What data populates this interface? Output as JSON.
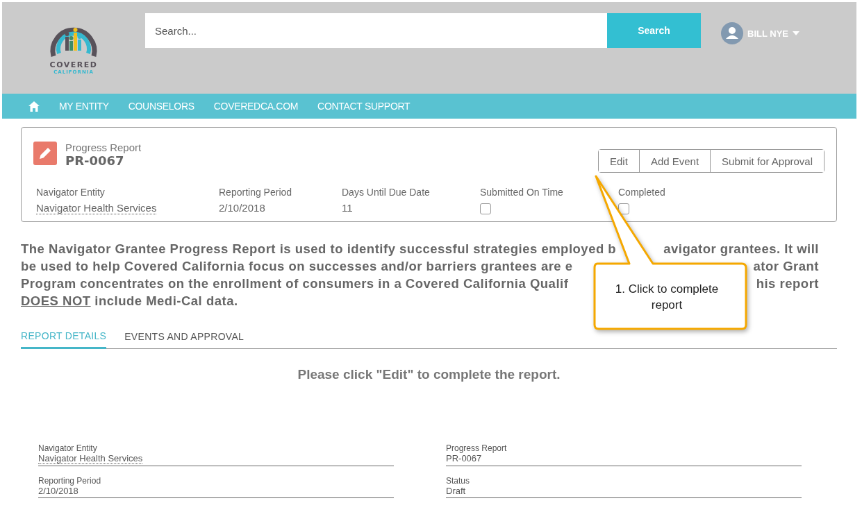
{
  "header": {
    "logo": {
      "line1": "COVERED",
      "line2": "CALIFORNIA"
    },
    "search": {
      "placeholder": "Search...",
      "button": "Search"
    },
    "user": {
      "name": "BILL NYE"
    }
  },
  "nav": {
    "items": [
      "MY ENTITY",
      "COUNSELORS",
      "COVEREDCA.COM",
      "CONTACT SUPPORT"
    ]
  },
  "record": {
    "type": "Progress Report",
    "name": "PR-0067",
    "actions": [
      "Edit",
      "Add Event",
      "Submit for Approval"
    ],
    "fields": [
      {
        "kind": "link",
        "label": "Navigator Entity",
        "value": "Navigator Health Services"
      },
      {
        "kind": "text",
        "label": "Reporting Period",
        "value": "2/10/2018"
      },
      {
        "kind": "text",
        "label": "Days Until Due Date",
        "value": "11"
      },
      {
        "kind": "checkbox",
        "label": "Submitted On Time",
        "checked": false
      },
      {
        "kind": "checkbox",
        "label": "Completed",
        "checked": false
      }
    ]
  },
  "intro": {
    "lines": [
      {
        "left": "The Navigator Grantee Progress Report is used to identify successful strategies employed b",
        "right": "avigator grantees. It will"
      },
      {
        "left": "be used to help Covered California focus on successes and/or barriers grantees are e",
        "right": "ator Grant"
      },
      {
        "left": "Program concentrates on the enrollment of consumers in a Covered California Qualif",
        "right": "his report"
      }
    ],
    "last_emphasis": "DOES NOT",
    "last_rest": " include Medi-Cal data."
  },
  "tabs": [
    {
      "label": "REPORT DETAILS",
      "selected": true
    },
    {
      "label": "EVENTS AND APPROVAL",
      "selected": false
    }
  ],
  "notice": "Please click \"Edit\" to complete the report.",
  "details": [
    {
      "kind": "link",
      "label": "Navigator Entity",
      "value": "Navigator Health Services"
    },
    {
      "kind": "text",
      "label": "Progress Report",
      "value": "PR-0067"
    },
    {
      "kind": "text",
      "label": "Reporting Period",
      "value": "2/10/2018"
    },
    {
      "kind": "text",
      "label": "Status",
      "value": "Draft"
    }
  ],
  "callout": {
    "text": "1. Click to complete report"
  }
}
